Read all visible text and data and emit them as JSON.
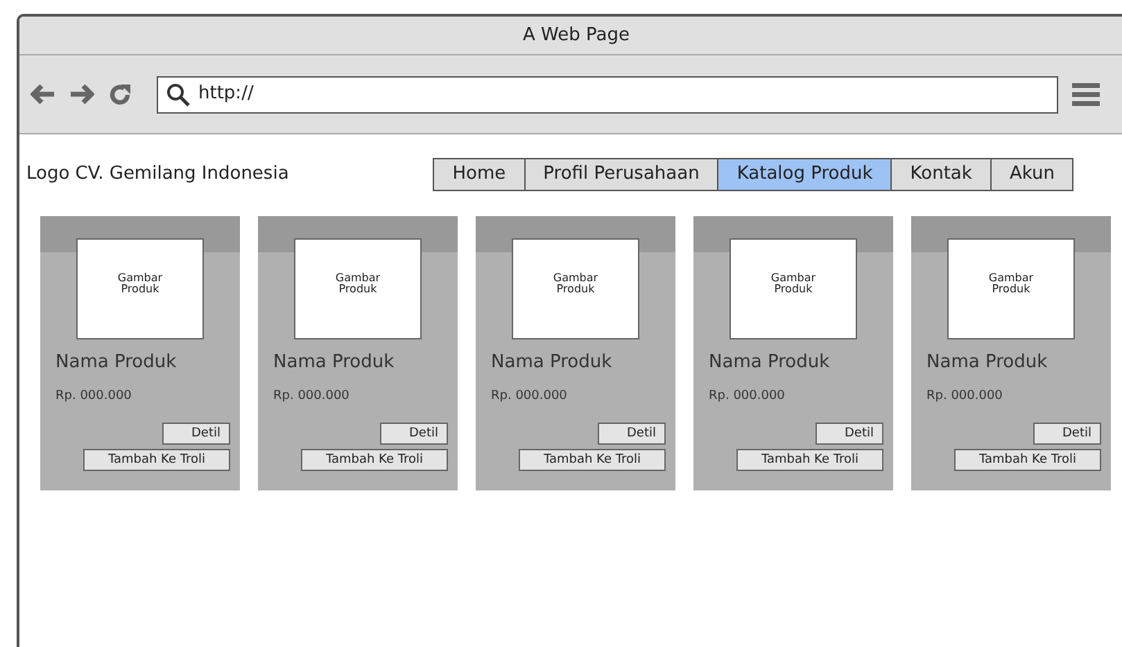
{
  "window": {
    "title": "A Web Page"
  },
  "address_bar": {
    "value": "http://"
  },
  "header": {
    "logo_text": "Logo CV. Gemilang Indonesia"
  },
  "nav": [
    {
      "label": "Home",
      "selected": false
    },
    {
      "label": "Profil Perusahaan",
      "selected": false
    },
    {
      "label": "Katalog Produk",
      "selected": true
    },
    {
      "label": "Kontak",
      "selected": false
    },
    {
      "label": "Akun",
      "selected": false
    }
  ],
  "products": [
    {
      "image_label": "Gambar Produk",
      "name": "Nama Produk",
      "price": "Rp. 000.000",
      "detail_button": "Detil",
      "cart_button": "Tambah Ke Troli"
    },
    {
      "image_label": "Gambar Produk",
      "name": "Nama Produk",
      "price": "Rp. 000.000",
      "detail_button": "Detil",
      "cart_button": "Tambah Ke Troli"
    },
    {
      "image_label": "Gambar Produk",
      "name": "Nama Produk",
      "price": "Rp. 000.000",
      "detail_button": "Detil",
      "cart_button": "Tambah Ke Troli"
    },
    {
      "image_label": "Gambar Produk",
      "name": "Nama Produk",
      "price": "Rp. 000.000",
      "detail_button": "Detil",
      "cart_button": "Tambah Ke Troli"
    },
    {
      "image_label": "Gambar Produk",
      "name": "Nama Produk",
      "price": "Rp. 000.000",
      "detail_button": "Detil",
      "cart_button": "Tambah Ke Troli"
    }
  ]
}
